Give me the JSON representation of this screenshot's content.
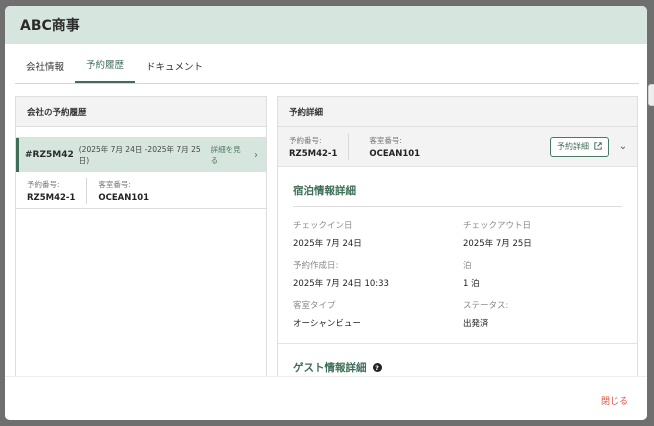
{
  "modal": {
    "title": "ABC商事",
    "close_label": "閉じる"
  },
  "tabs": [
    {
      "label": "会社情報",
      "active": false
    },
    {
      "label": "予約履歴",
      "active": true
    },
    {
      "label": "ドキュメント",
      "active": false
    }
  ],
  "history_panel": {
    "title": "会社の予約履歴",
    "item": {
      "id": "#RZ5M42",
      "dates": "(2025年 7月 24日 -2025年 7月 25日)",
      "link_label": "詳細を見る",
      "booking_label": "予約番号:",
      "booking_value": "RZ5M42-1",
      "room_label": "客室番号:",
      "room_value": "OCEAN101"
    }
  },
  "detail_panel": {
    "title": "予約詳細",
    "booking_label": "予約番号:",
    "booking_value": "RZ5M42-1",
    "room_label": "客室番号:",
    "room_value": "OCEAN101",
    "detail_button": "予約詳細",
    "stay_section": {
      "title": "宿泊情報詳細",
      "fields": [
        {
          "label": "チェックイン日",
          "value": "2025年 7月 24日"
        },
        {
          "label": "チェックアウト日",
          "value": "2025年 7月 25日"
        },
        {
          "label": "予約作成日:",
          "value": "2025年 7月 24日 10:33"
        },
        {
          "label": "泊",
          "value": "1 泊"
        },
        {
          "label": "客室タイプ",
          "value": "オーシャンビュー"
        },
        {
          "label": "ステータス:",
          "value": "出発済"
        }
      ]
    },
    "guest_section": {
      "title": "ゲスト情報詳細"
    }
  },
  "colors": {
    "accent": "#3e6e57",
    "header_bg": "#d6e6de",
    "close": "#d9533f"
  }
}
